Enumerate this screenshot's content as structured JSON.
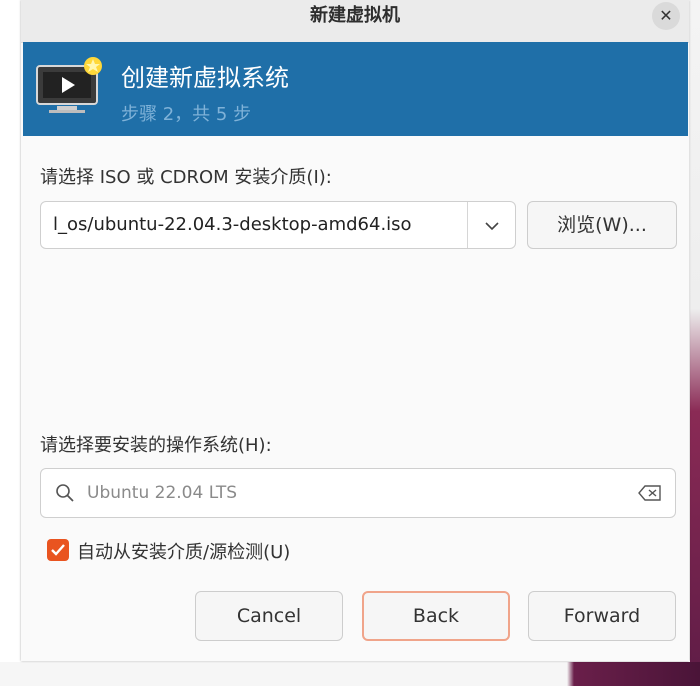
{
  "window": {
    "title": "新建虚拟机",
    "close_glyph": "✕"
  },
  "banner": {
    "icon": "vm-screen-star-icon",
    "title": "创建新虚拟系统",
    "step": "步骤 2，共 5 步"
  },
  "iso": {
    "label": "请选择 ISO 或 CDROM 安装介质(I):",
    "value": "l_os/ubuntu-22.04.3-desktop-amd64.iso",
    "browse_label": "浏览(W)..."
  },
  "os": {
    "label": "请选择要安装的操作系统(H):",
    "search_value": "Ubuntu 22.04 LTS"
  },
  "auto_detect": {
    "label": "自动从安装介质/源检测(U)",
    "checked": true
  },
  "buttons": {
    "cancel": "Cancel",
    "back": "Back",
    "forward": "Forward"
  },
  "colors": {
    "banner_bg": "#1f6fa8",
    "accent": "#e95420"
  }
}
